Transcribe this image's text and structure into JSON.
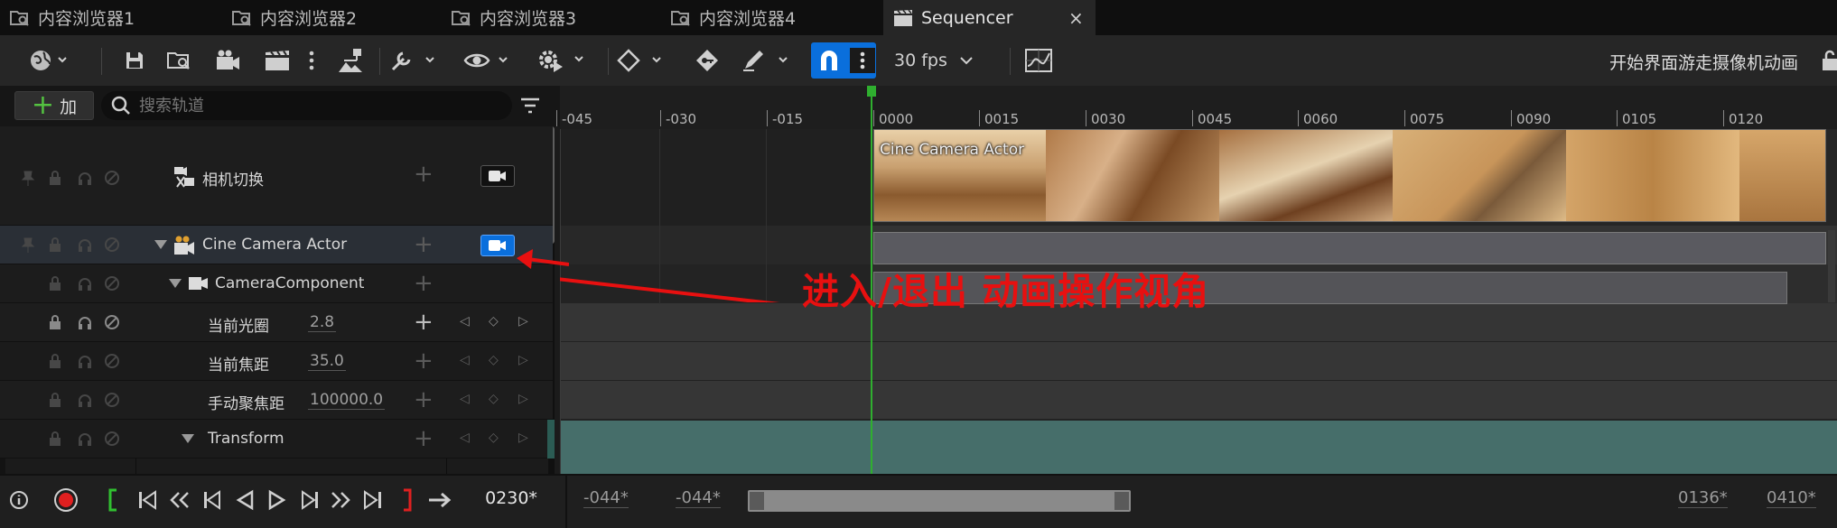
{
  "tabs": [
    {
      "label": "内容浏览器1"
    },
    {
      "label": "内容浏览器2"
    },
    {
      "label": "内容浏览器3"
    },
    {
      "label": "内容浏览器4"
    },
    {
      "label": "Sequencer",
      "close": "×"
    }
  ],
  "toolbar": {
    "fps_label": "30 fps",
    "sequence_name": "开始界面游走摄像机动画"
  },
  "left": {
    "add_label": "加",
    "add_symbol": "+",
    "search_placeholder": "搜索轨道"
  },
  "tracks": {
    "camera_cut": "相机切换",
    "actor": "Cine Camera Actor",
    "component": "CameraComponent",
    "aperture": {
      "label": "当前光圈",
      "value": "2.8"
    },
    "focal": {
      "label": "当前焦距",
      "value": "35.0"
    },
    "focus": {
      "label": "手动聚焦距",
      "value": "100000.0"
    },
    "transform": "Transform"
  },
  "ruler": [
    "-045",
    "-030",
    "-015",
    "0000",
    "0015",
    "0030",
    "0045",
    "0060",
    "0075",
    "0090",
    "0105",
    "0120"
  ],
  "clip_label": "Cine Camera Actor",
  "annotation": "进入/退出  动画操作视角",
  "bottom": {
    "current_frame": "0230*",
    "view_start": "-044*",
    "play_start": "-044*",
    "play_end": "0136*",
    "view_end": "0410*"
  },
  "colors": {
    "accent": "#0a6fdc",
    "teal": "#466e6a",
    "annotation": "#e81010",
    "playhead": "#2faf2f"
  }
}
